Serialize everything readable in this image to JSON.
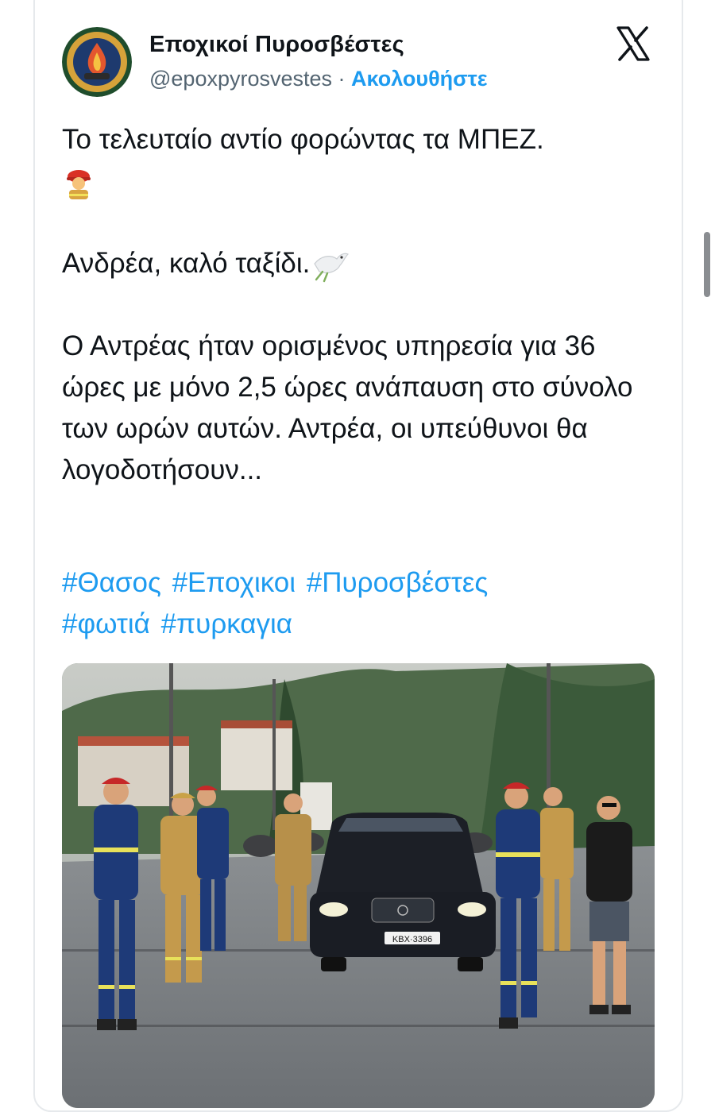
{
  "tweet": {
    "display_name": "Εποχικοί Πυροσβέστες",
    "handle": "@epoxpyrosvestes",
    "separator": "·",
    "follow_label": "Ακολουθήστε",
    "avatar_icon": "firefighter-badge-icon",
    "platform_icon": "x-logo-icon",
    "lines": {
      "p1": "Το τελευταίο αντίο φορώντας τα ΜΠΕΖ.",
      "p1_emoji": "firefighter-emoji-icon",
      "p2": "Ανδρέα, καλό ταξίδι.",
      "p2_emoji": "dove-emoji-icon",
      "p3": "Ο Αντρέας ήταν ορισμένος υπηρεσία για 36 ώρες με μόνο 2,5 ώρες ανάπαυση στο σύνολο των ωρών αυτών. Αντρέα, οι υπεύθυνοι θα λογοδοτήσουν..."
    },
    "hashtags": [
      "#Θασος",
      "#Εποχικοι",
      "#Πυροσβέστες",
      "#φωτιά",
      "#πυρκαγια"
    ],
    "photo": {
      "license_plate": "ΚΒΧ·3396"
    }
  },
  "colors": {
    "link": "#1d9bf0",
    "text": "#0f1419",
    "secondary": "#536471",
    "border": "#e6e9ec"
  }
}
